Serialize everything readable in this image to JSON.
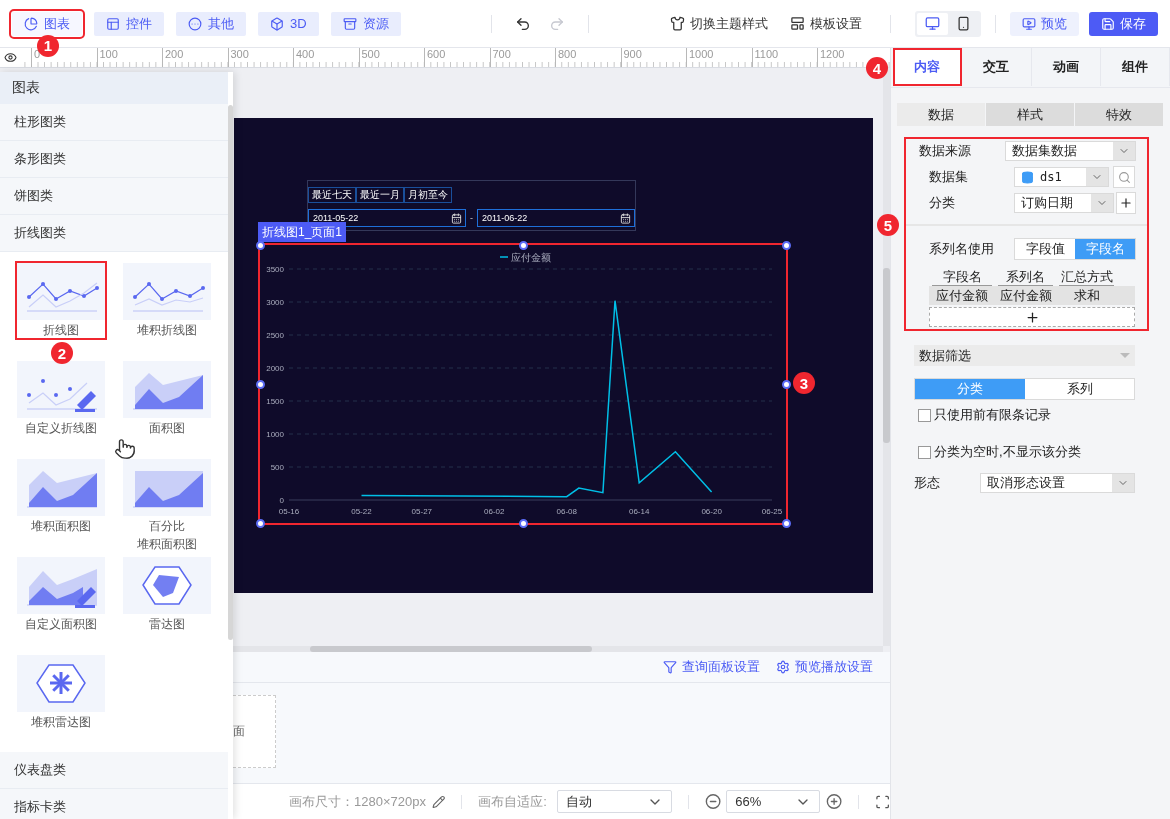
{
  "toolbar": {
    "tabs": [
      {
        "label": "图表",
        "kind": "chart",
        "selected": true,
        "highlighted": true,
        "marker": "1"
      },
      {
        "label": "控件",
        "kind": "control",
        "selected": false,
        "highlighted": false
      },
      {
        "label": "其他",
        "kind": "other",
        "selected": false,
        "highlighted": false
      },
      {
        "label": "3D",
        "kind": "cube",
        "selected": false,
        "highlighted": false
      },
      {
        "label": "资源",
        "kind": "resource",
        "selected": false,
        "highlighted": false
      }
    ],
    "history": [
      {
        "kind": "undo",
        "disabled": false
      },
      {
        "kind": "redo",
        "disabled": true
      }
    ],
    "actions": [
      {
        "label": "切换主题样式",
        "kind": "theme"
      },
      {
        "label": "模板设置",
        "kind": "template"
      }
    ],
    "devices": [
      {
        "kind": "desktop",
        "selected": true
      },
      {
        "kind": "mobile",
        "selected": false
      }
    ],
    "preview": "预览",
    "save": "保存"
  },
  "ruler": {
    "labels": [
      "0",
      "100",
      "200",
      "300",
      "400",
      "500",
      "600",
      "700",
      "800",
      "900",
      "1000",
      "1100",
      "1200"
    ]
  },
  "component_panel": {
    "title": "图表",
    "categories": [
      {
        "label": "柱形图类"
      },
      {
        "label": "条形图类"
      },
      {
        "label": "饼图类"
      },
      {
        "label": "折线图类",
        "children": [
          {
            "label": "折线图",
            "kind": "line",
            "highlighted": true,
            "marker": "2"
          },
          {
            "label": "堆积折线图",
            "kind": "stackedline",
            "highlighted": false
          },
          {
            "label": "自定义折线图",
            "kind": "customline",
            "highlighted": false
          },
          {
            "label": "面积图",
            "kind": "area",
            "highlighted": false
          },
          {
            "label": "堆积面积图",
            "kind": "stackedarea",
            "highlighted": false
          },
          {
            "label": [
              "百分比",
              "堆积面积图"
            ],
            "kind": "percentarea",
            "highlighted": false
          },
          {
            "label": "自定义面积图",
            "kind": "customarea",
            "highlighted": false
          },
          {
            "label": "雷达图",
            "kind": "radar",
            "highlighted": false
          },
          {
            "label": "堆积雷达图",
            "kind": "stackedradar",
            "highlighted": false
          }
        ]
      },
      {
        "label": "仪表盘类"
      },
      {
        "label": "指标卡类"
      }
    ]
  },
  "canvas": {
    "query_widget": {
      "quick_buttons": [
        "最近七天",
        "最近一月",
        "月初至今"
      ],
      "start_date": "2011-05-22",
      "separator": "-",
      "end_date": "2011-06-22"
    },
    "chart_widget": {
      "name": "折线图1_页面1",
      "highlighted": true,
      "marker": "3",
      "chart_data": {
        "type": "line",
        "categories": [
          "05-16",
          null,
          null,
          null,
          null,
          null,
          "05-22",
          null,
          null,
          null,
          null,
          "05-27",
          null,
          null,
          null,
          null,
          null,
          "06-02",
          null,
          null,
          null,
          null,
          null,
          "06-08",
          null,
          null,
          null,
          null,
          null,
          "06-14",
          null,
          null,
          null,
          null,
          null,
          "06-20",
          null,
          null,
          null,
          null,
          "06-25"
        ],
        "series": [
          {
            "name": "应付金额",
            "color": "#00bfe6",
            "values": [
              null,
              null,
              null,
              null,
              null,
              null,
              70,
              null,
              null,
              null,
              null,
              null,
              null,
              null,
              null,
              null,
              null,
              null,
              null,
              null,
              null,
              null,
              null,
              50,
              180,
              null,
              110,
              3020,
              null,
              260,
              null,
              null,
              730,
              null,
              null,
              120,
              null,
              null,
              null,
              null,
              null
            ]
          }
        ],
        "ylim": [
          0,
          3500
        ],
        "grid": true,
        "yticks": [
          0,
          500,
          1000,
          1500,
          2000,
          2500,
          3000,
          3500
        ]
      }
    }
  },
  "page_panel": {
    "links": [
      {
        "label": "查询面板设置",
        "kind": "filter"
      },
      {
        "label": "预览播放设置",
        "kind": "settings"
      }
    ],
    "pages": [
      {
        "label": "面"
      }
    ]
  },
  "status_bar": {
    "size_label": "画布尺寸：",
    "size_value": "1280×720px",
    "fit_label": "画布自适应:",
    "fit_value": "自动",
    "zoom_value": "66%"
  },
  "inspector": {
    "tabs": [
      {
        "label": "内容",
        "selected": true,
        "highlighted": true,
        "marker": "4"
      },
      {
        "label": "交互",
        "selected": false,
        "highlighted": false
      },
      {
        "label": "动画",
        "selected": false,
        "highlighted": false
      },
      {
        "label": "组件",
        "selected": false,
        "highlighted": false
      }
    ],
    "subtabs": [
      {
        "label": "数据",
        "selected": true
      },
      {
        "label": "样式",
        "selected": false
      },
      {
        "label": "特效",
        "selected": false
      }
    ],
    "data_section": {
      "highlighted": true,
      "marker": "5",
      "source": {
        "label": "数据来源",
        "value": "数据集数据"
      },
      "dataset": {
        "label": "数据集",
        "value": "ds1"
      },
      "category": {
        "label": "分类",
        "value": "订购日期"
      },
      "series_name": {
        "label": "系列名使用",
        "options": [
          {
            "label": "字段值",
            "selected": false
          },
          {
            "label": "字段名",
            "selected": true
          }
        ]
      },
      "series_table": {
        "columns": [
          "字段名",
          "系列名",
          "汇总方式"
        ],
        "rows": [
          [
            "应付金额",
            "应付金额",
            "求和"
          ]
        ]
      }
    },
    "filter": {
      "label": "数据筛选"
    },
    "filter_tabs": [
      {
        "label": "分类",
        "selected": true
      },
      {
        "label": "系列",
        "selected": false
      }
    ],
    "checkboxes": [
      {
        "label": "只使用前有限条记录",
        "checked": false
      },
      {
        "label": "分类为空时,不显示该分类",
        "checked": false
      }
    ],
    "form": {
      "label": "形态",
      "value": "取消形态设置"
    }
  }
}
